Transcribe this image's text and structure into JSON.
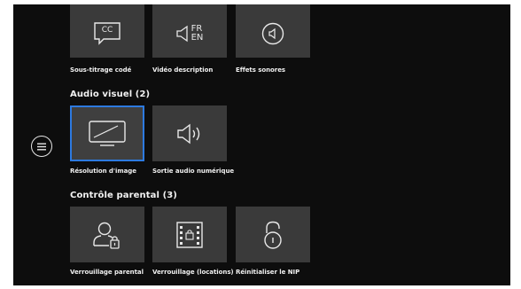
{
  "sections": {
    "accessibility": {
      "tiles": [
        {
          "label": "Sous-titrage codé",
          "icon": "closed-caption-icon",
          "icon_text": "CC"
        },
        {
          "label": "Vidéo description",
          "icon": "video-description-icon",
          "icon_text_top": "FR",
          "icon_text_bottom": "EN"
        },
        {
          "label": "Effets sonores",
          "icon": "sound-effects-icon"
        }
      ]
    },
    "audio_visual": {
      "title": "Audio visuel (2)",
      "tiles": [
        {
          "label": "Résolution d'image",
          "icon": "picture-resolution-icon",
          "selected": true
        },
        {
          "label": "Sortie audio numérique",
          "icon": "speaker-icon"
        }
      ]
    },
    "parental": {
      "title": "Contrôle parental (3)",
      "tiles": [
        {
          "label": "Verrouillage parental",
          "icon": "user-lock-icon"
        },
        {
          "label": "Verrouillage (locations)",
          "icon": "film-lock-icon"
        },
        {
          "label": "Réinitialiser le NIP",
          "icon": "unlock-icon"
        }
      ]
    }
  },
  "colors": {
    "background": "#0d0d0d",
    "tile": "#3a3a3a",
    "selection": "#2d7ae0",
    "text": "#f0f0f0"
  }
}
